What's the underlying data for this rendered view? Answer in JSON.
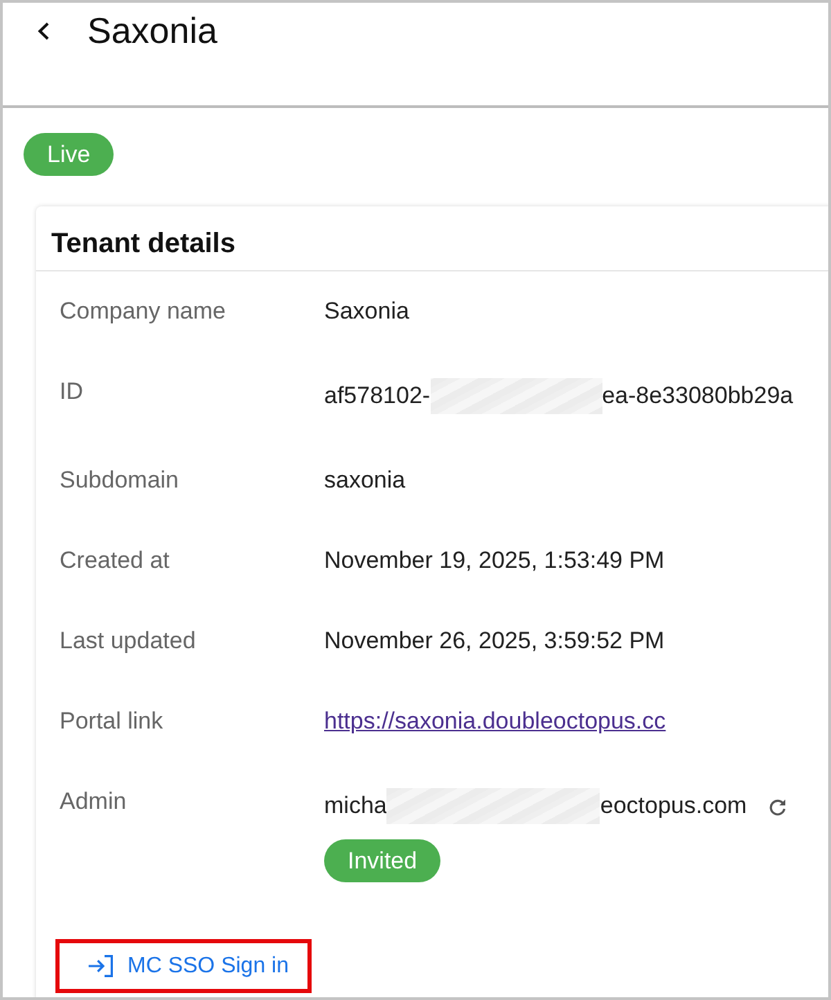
{
  "header": {
    "title": "Saxonia"
  },
  "status_badge": {
    "label": "Live"
  },
  "card": {
    "title": "Tenant details",
    "rows": [
      {
        "kind": "text",
        "label": "Company name",
        "value": "Saxonia"
      },
      {
        "kind": "redacted",
        "label": "ID",
        "value_parts": [
          "af578102-",
          "ea-8e33080bb29a"
        ]
      },
      {
        "kind": "text",
        "label": "Subdomain",
        "value": "saxonia"
      },
      {
        "kind": "text",
        "label": "Created at",
        "value": "November 19, 2025, 1:53:49 PM"
      },
      {
        "kind": "text",
        "label": "Last updated",
        "value": "November 26, 2025, 3:59:52 PM"
      },
      {
        "kind": "link",
        "label": "Portal link",
        "value": "https://saxonia.doubleoctopus.cc"
      },
      {
        "kind": "admin",
        "label": "Admin",
        "value_parts": [
          "micha",
          "eoctopus.com"
        ],
        "badge": "Invited"
      }
    ],
    "sso_button": {
      "label": "MC SSO Sign in",
      "highlighted": true
    }
  }
}
